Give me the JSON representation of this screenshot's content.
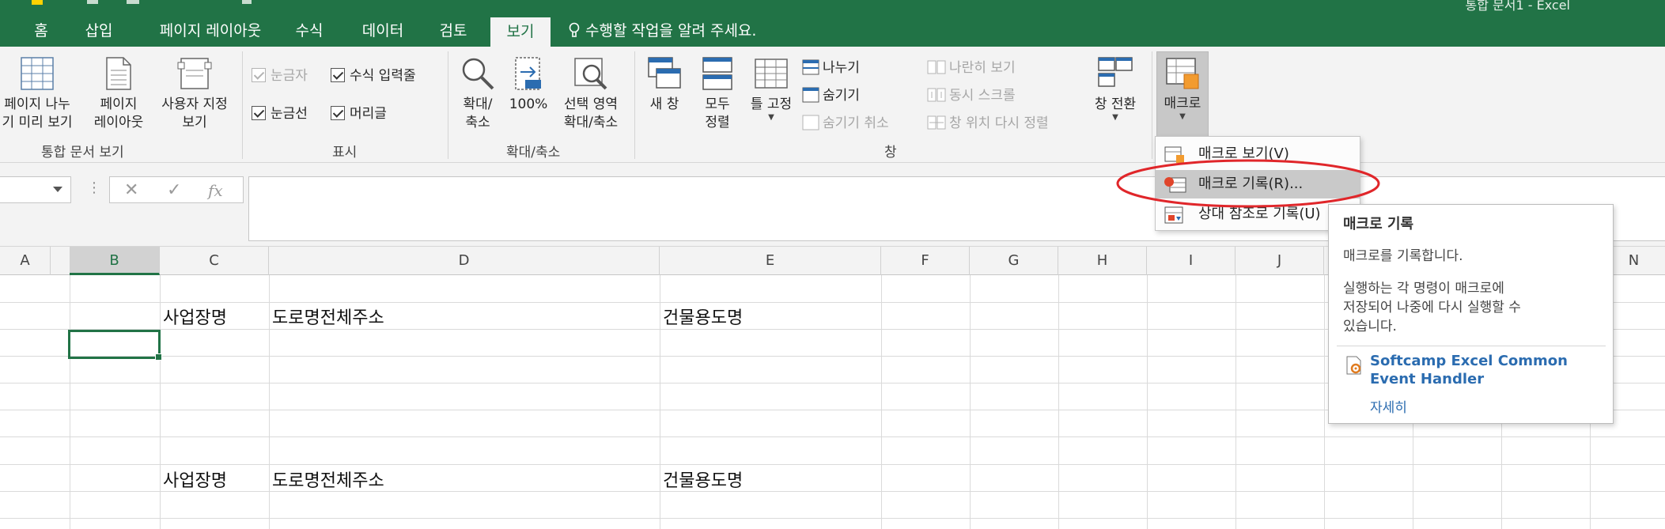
{
  "window": {
    "title": "통합 문서1 - Excel"
  },
  "tabs": [
    {
      "label": "홈"
    },
    {
      "label": "삽입"
    },
    {
      "label": "페이지 레이아웃"
    },
    {
      "label": "수식"
    },
    {
      "label": "데이터"
    },
    {
      "label": "검토"
    },
    {
      "label": "보기",
      "active": true
    }
  ],
  "tell_me": "수행할 작업을 알려 주세요.",
  "ribbon": {
    "workbook_views": {
      "label": "통합 문서 보기",
      "page_break_line1": "페이지 나누",
      "page_break_line2": "기 미리 보기",
      "page_layout_line1": "페이지",
      "page_layout_line2": "레이아웃",
      "custom_line1": "사용자 지정",
      "custom_line2": "보기"
    },
    "show": {
      "label": "표시",
      "ruler": "눈금자",
      "formula_bar": "수식 입력줄",
      "gridlines": "눈금선",
      "headings": "머리글"
    },
    "zoom": {
      "label": "확대/축소",
      "zoom_line1": "확대/",
      "zoom_line2": "축소",
      "hundred": "100%",
      "selection_line1": "선택 영역",
      "selection_line2": "확대/축소"
    },
    "window": {
      "label": "창",
      "new_window": "새 창",
      "arrange_line1": "모두",
      "arrange_line2": "정렬",
      "freeze": "틀 고정",
      "split": "나누기",
      "hide": "숨기기",
      "unhide": "숨기기 취소",
      "side_by_side": "나란히 보기",
      "sync_scroll": "동시 스크롤",
      "reset_position": "창 위치 다시 정렬",
      "switch": "창 전환"
    },
    "macros": {
      "label": "매크로"
    }
  },
  "formula_bar": {
    "fx": "fx"
  },
  "columns": [
    "A",
    "B",
    "C",
    "D",
    "E",
    "F",
    "G",
    "H",
    "I",
    "J",
    "N"
  ],
  "cells": {
    "r2c": "사업장명",
    "r2d": "도로명전체주소",
    "r2e": "건물용도명",
    "r8c": "사업장명",
    "r8d": "도로명전체주소",
    "r8e": "건물용도명"
  },
  "macro_menu": {
    "view": "매크로 보기(V)",
    "record": "매크로 기록(R)...",
    "relative": "상대 참조로 기록(U)"
  },
  "tooltip": {
    "title": "매크로 기록",
    "desc": "매크로를 기록합니다.",
    "detail": "실행하는 각 명령이 매크로에\n저장되어 나중에 다시 실행할 수\n있습니다.",
    "addin": "Softcamp Excel Common Event Handler",
    "more": "자세히"
  },
  "colors": {
    "brand": "#217346",
    "ribbon": "#f3f3f3",
    "highlight_ellipse": "#e0262a",
    "link": "#2b6cb0"
  }
}
